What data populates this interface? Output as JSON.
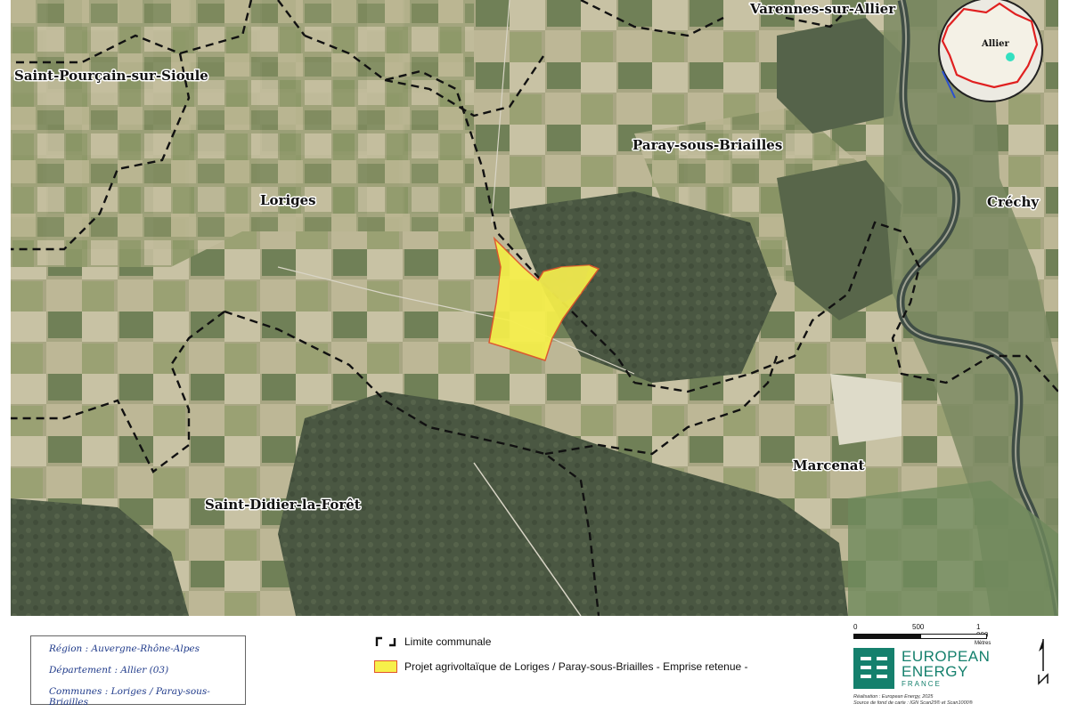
{
  "places": {
    "varennes": "Varennes-sur-Allier",
    "saint_pourcain": "Saint-Pourçain-sur-Sioule",
    "paray": "Paray-sous-Briailles",
    "loriges": "Loriges",
    "crechy": "Créchy",
    "marcenat": "Marcenat",
    "saint_didier": "Saint-Didier-la-Forêt"
  },
  "inset": {
    "label": "Allier"
  },
  "info": {
    "region": "Région : Auvergne-Rhône-Alpes",
    "departement": "Département : Allier (03)",
    "communes": "Communes : Loriges / Paray-sous-Briailles"
  },
  "legend": {
    "limit": "Limite communale",
    "project": "Projet agrivoltaïque de Loriges / Paray-sous-Briailles - Emprise retenue -"
  },
  "scale": {
    "tick0": "0",
    "tick1": "500",
    "tick2": "1 000",
    "unit": "Mètres"
  },
  "logo": {
    "line1": "EUROPEAN",
    "line2": "ENERGY",
    "line3": "FRANCE"
  },
  "credits": {
    "line1": "Réalisation : European Energy, 2025",
    "line2": "Source de fond de carte : IGN Scan25® et Scan1000®"
  },
  "colors": {
    "project_fill": "#f7f04a",
    "project_stroke": "#e0542a",
    "boundary": "#111111",
    "brand": "#15806d",
    "inset_border": "#e02020"
  }
}
